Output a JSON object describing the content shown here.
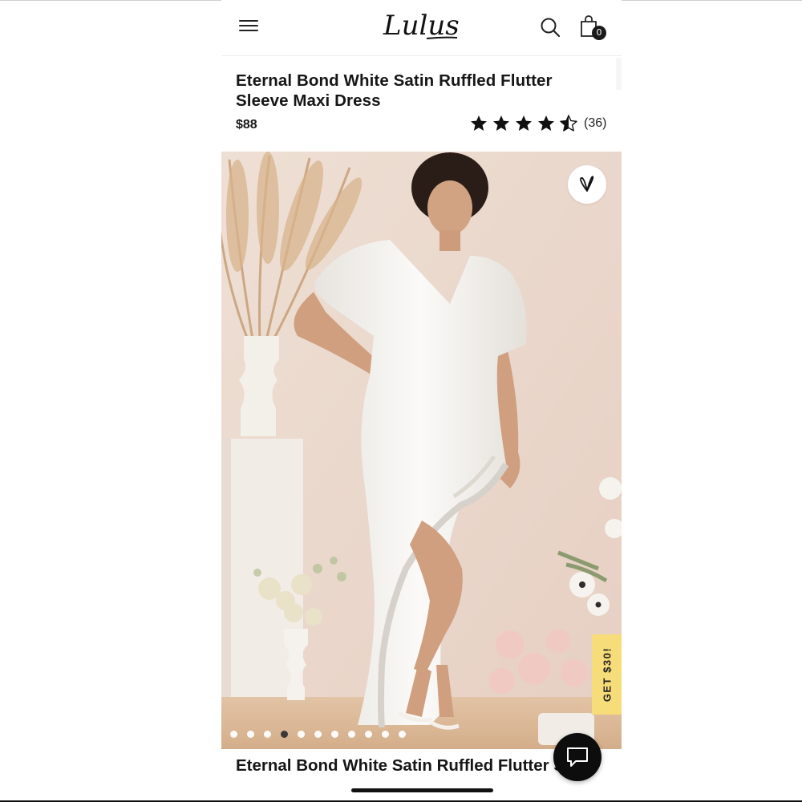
{
  "header": {
    "logo_text": "Lulus",
    "bag_count": "0",
    "icons": [
      "menu-icon",
      "search-icon",
      "shopping-bag-icon"
    ]
  },
  "product": {
    "title": "Eternal Bond White Satin Ruffled Flutter Sleeve Maxi Dress",
    "price": "$88",
    "rating": 4.5,
    "review_count": "(36)"
  },
  "gallery": {
    "image_count": 11,
    "active_index": 3,
    "wishlist_icon": "heart-icon",
    "promo_label": "GET $30!"
  },
  "footer": {
    "title": "Eternal Bond White Satin Ruffled Flutter Sleeve Maxi Dress",
    "chat_icon": "chat-bubble-icon"
  },
  "colors": {
    "text": "#161616",
    "promo": "#f7dc7a",
    "backdrop": "#ecd8cc",
    "dark_button": "#0d0d0d"
  }
}
